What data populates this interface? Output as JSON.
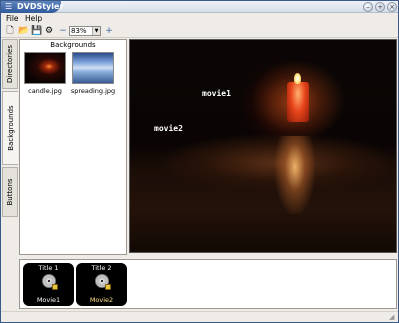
{
  "window": {
    "title": "DVDStyler"
  },
  "menubar": {
    "file": "File",
    "help": "Help"
  },
  "toolbar": {
    "zoom_value": "83%"
  },
  "sidetabs": {
    "directories": "Directories",
    "backgrounds": "Backgrounds",
    "buttons": "Buttons"
  },
  "backgrounds": {
    "title": "Backgrounds",
    "items": [
      {
        "label": "candle.jpg"
      },
      {
        "label": "spreading.jpg"
      }
    ]
  },
  "preview": {
    "buttons": [
      "movie1",
      "movie2"
    ]
  },
  "titles": [
    {
      "label": "Title 1",
      "sublabel": "Movie1",
      "selected": false
    },
    {
      "label": "Title 2",
      "sublabel": "Movie2",
      "selected": true
    }
  ],
  "colors": {
    "accent": "#2f5a9c",
    "selected_text": "#ffe28a"
  }
}
